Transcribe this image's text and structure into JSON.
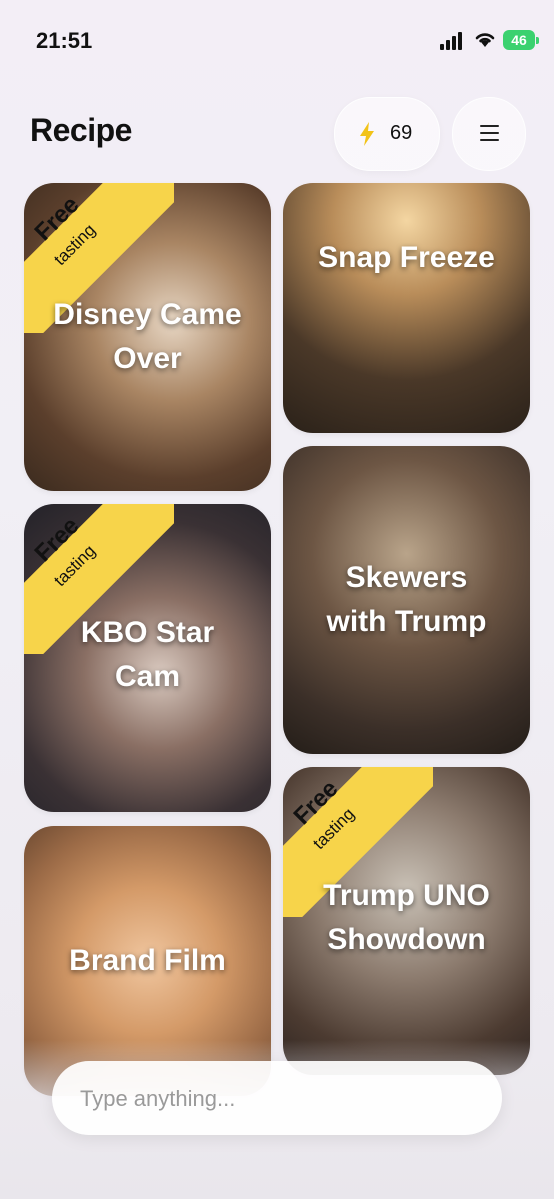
{
  "status_bar": {
    "time": "21:51",
    "battery": "46",
    "icons": [
      "signal-icon",
      "wifi-icon",
      "battery-icon"
    ]
  },
  "header": {
    "title": "Recipe",
    "credits": "69",
    "credits_icon": "lightning-bolt-icon",
    "menu_icon": "hamburger-menu-icon"
  },
  "colors": {
    "ribbon": "#f7d44a",
    "bolt": "#f2c318",
    "battery": "#3bd16f"
  },
  "recipes": [
    {
      "title": "Disney Came Over",
      "ribbon_line1": "Free",
      "ribbon_line2": "tasting"
    },
    {
      "title": "Snap Freeze"
    },
    {
      "title": "KBO Star Cam",
      "ribbon_line1": "Free",
      "ribbon_line2": "tasting"
    },
    {
      "title": "Skewers with Trump"
    },
    {
      "title": "Brand Film"
    },
    {
      "title": "Trump UNO Showdown",
      "ribbon_line1": "Free",
      "ribbon_line2": "tasting"
    }
  ],
  "composer": {
    "placeholder": "Type anything..."
  }
}
